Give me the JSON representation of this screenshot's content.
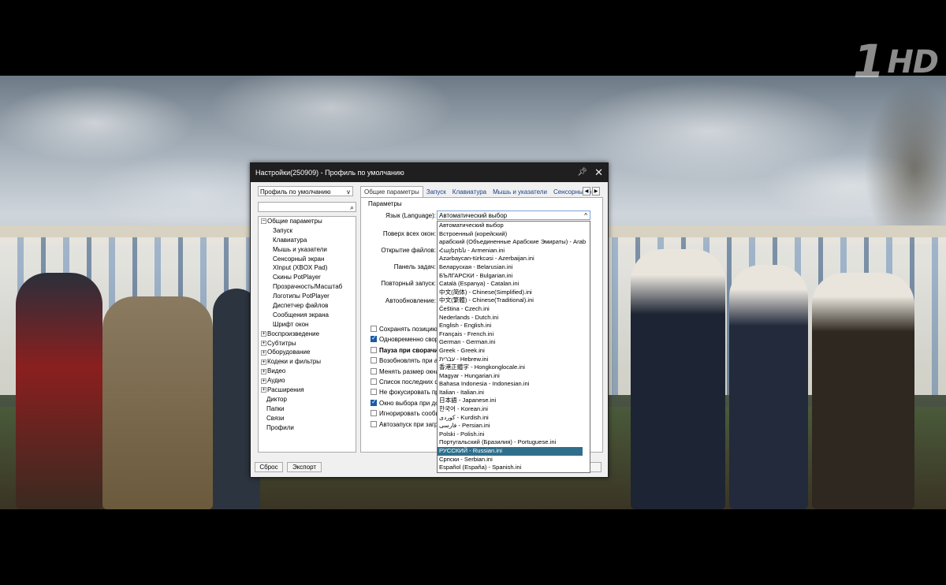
{
  "channel_logo": {
    "text": "1",
    "suffix": "HD"
  },
  "dialog": {
    "title": "Настройки(250909) - Профиль по умолчанию",
    "pin_icon": "pin-icon",
    "close_icon": "close-icon",
    "profile_select": "Профиль по умолчанию",
    "tree": [
      {
        "label": "Общие параметры",
        "level": 0,
        "expander": "minus"
      },
      {
        "label": "Запуск",
        "level": 1
      },
      {
        "label": "Клавиатура",
        "level": 1
      },
      {
        "label": "Мышь и указатели",
        "level": 1
      },
      {
        "label": "Сенсорный экран",
        "level": 1
      },
      {
        "label": "XInput (XBOX Pad)",
        "level": 1
      },
      {
        "label": "Скины PotPlayer",
        "level": 1
      },
      {
        "label": "Прозрачность/Масштаб",
        "level": 1
      },
      {
        "label": "Логотипы PotPlayer",
        "level": 1
      },
      {
        "label": "Диспетчер файлов",
        "level": 1
      },
      {
        "label": "Сообщения экрана",
        "level": 1
      },
      {
        "label": "Шрифт окон",
        "level": 1
      },
      {
        "label": "Воспроизведение",
        "level": 0,
        "expander": "plus"
      },
      {
        "label": "Субтитры",
        "level": 0,
        "expander": "plus"
      },
      {
        "label": "Оборудование",
        "level": 0,
        "expander": "plus"
      },
      {
        "label": "Кодеки и фильтры",
        "level": 0,
        "expander": "plus"
      },
      {
        "label": "Видео",
        "level": 0,
        "expander": "plus"
      },
      {
        "label": "Аудио",
        "level": 0,
        "expander": "plus"
      },
      {
        "label": "Расширения",
        "level": 0,
        "expander": "plus"
      },
      {
        "label": "Диктор",
        "level": 0
      },
      {
        "label": "Папки",
        "level": 0
      },
      {
        "label": "Связи",
        "level": 0
      },
      {
        "label": "Профили",
        "level": 0
      }
    ],
    "buttons": {
      "reset": "Сброс",
      "export": "Экспорт",
      "ok_fragment": "ть"
    },
    "tabs": [
      "Общие параметры",
      "Запуск",
      "Клавиатура",
      "Мышь и указатели",
      "Сенсорный э"
    ],
    "params_label": "Параметры",
    "field_labels": {
      "language": "Язык (Language):",
      "on_top": "Поверх всех окон:",
      "open_files": "Открытие файлов:",
      "taskbar": "Панель задач:",
      "repeat_start": "Повторный запуск:",
      "autoupdate": "Автообновление:"
    },
    "language_value": "Автоматический выбор",
    "checkboxes": [
      {
        "label": "Сохранять позицию п",
        "checked": false,
        "bold": false
      },
      {
        "label": "Одновременно свор",
        "checked": true,
        "bold": false
      },
      {
        "label": "Пауза при сворачив",
        "checked": false,
        "bold": true
      },
      {
        "label": "Возобновлять при ак",
        "checked": false,
        "bold": false
      },
      {
        "label": "Менять размер окна",
        "checked": false,
        "bold": false
      },
      {
        "label": "Список последних фа",
        "checked": false,
        "bold": false
      },
      {
        "label": "Не фокусировать при",
        "checked": false,
        "bold": false
      },
      {
        "label": "Окно выбора при до",
        "checked": true,
        "bold": false
      },
      {
        "label": "Игнорировать сообщ",
        "checked": false,
        "bold": false
      },
      {
        "label": "Автозапуск при загру",
        "checked": false,
        "bold": false
      }
    ]
  },
  "dropdown": {
    "options": [
      "Автоматический выбор",
      "Встроенный (корейский)",
      "арабский (Объединенные Арабские Эмираты) - Arab",
      "Հայերեն - Armenian.ini",
      "Azərbaycan-türkcəsi - Azerbaijan.ini",
      "Беларуская - Belarusian.ini",
      "БЪЛГАРСКИ - Bulgarian.ini",
      "Català (Espanya) - Catalan.ini",
      "中文(简体) - Chinese(Simplified).ini",
      "中文(繁體) - Chinese(Traditional).ini",
      "Čeština - Czech.ini",
      "Nederlands - Dutch.ini",
      "English - English.ini",
      "Français - French.ini",
      "German - German.ini",
      "Greek - Greek.ini",
      "עברית - Hebrew.ini",
      "香港正體字 - Hongkonglocale.ini",
      "Magyar - Hungarian.ini",
      "Bahasa Indonesia - Indonesian.ini",
      "Italian - Italian.ini",
      "日本語 - Japanese.ini",
      "한국어 - Korean.ini",
      "کوردی - Kurdish.ini",
      "فارسی - Persian.ini",
      "Polski - Polish.ini",
      "Португальский (Бразилия) - Portuguese.ini",
      "РУССКИЙ - Russian.ini",
      "Српски - Serbian.ini",
      "Español (España) - Spanish.ini"
    ],
    "selected": "РУССКИЙ - Russian.ini"
  }
}
